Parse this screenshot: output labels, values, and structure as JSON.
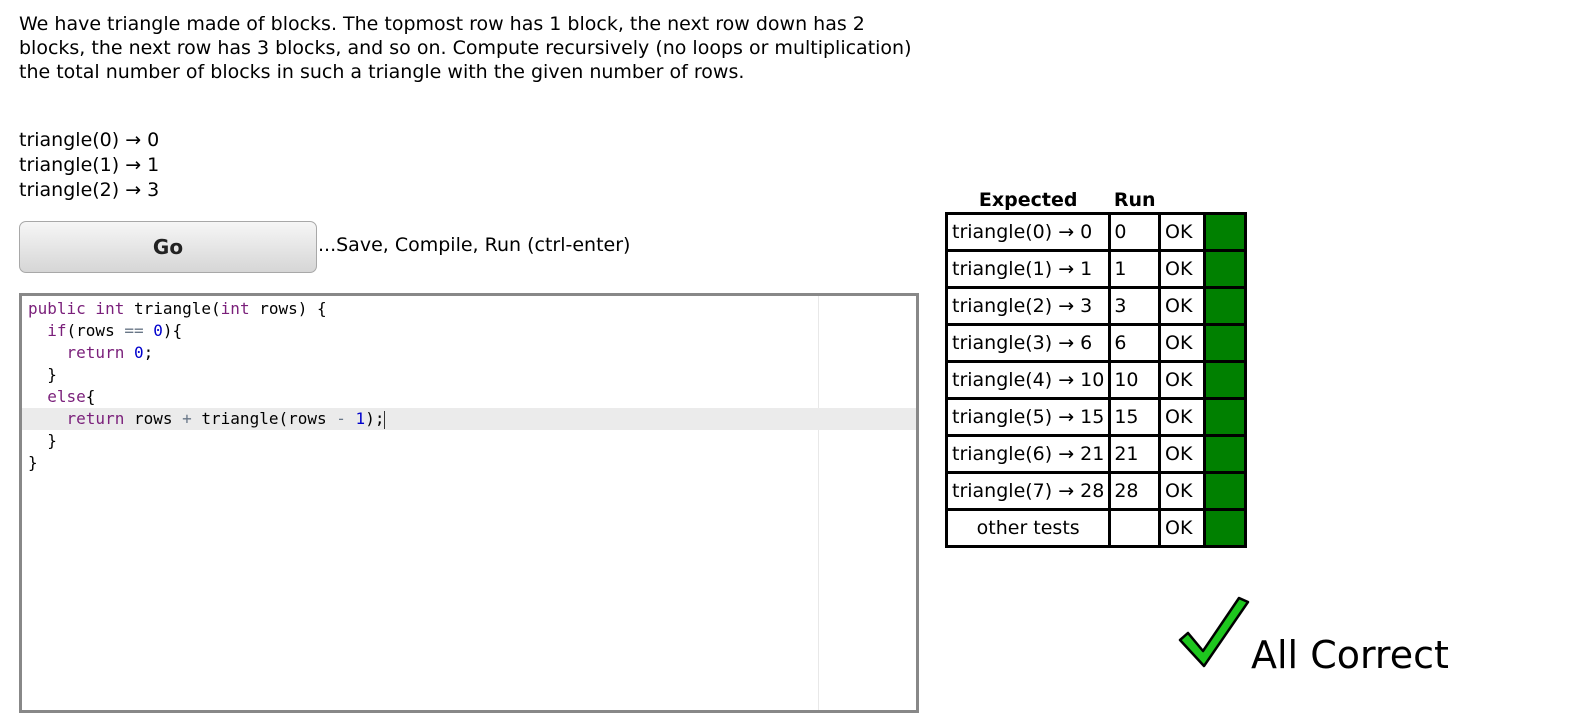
{
  "problem": {
    "description": "We have triangle made of blocks. The topmost row has 1 block, the next row down has 2 blocks, the next row has 3 blocks, and so on. Compute recursively (no loops or multiplication) the total number of blocks in such a triangle with the given number of rows.",
    "examples": [
      "triangle(0) → 0",
      "triangle(1) → 1",
      "triangle(2) → 3"
    ]
  },
  "controls": {
    "go_label": "Go",
    "go_hint": "...Save, Compile, Run (ctrl-enter)"
  },
  "editor": {
    "lines": [
      [
        {
          "t": "public int ",
          "c": "kw"
        },
        {
          "t": "triangle(",
          "c": "plain"
        },
        {
          "t": "int",
          "c": "kw"
        },
        {
          "t": " rows) {",
          "c": "plain"
        }
      ],
      [
        {
          "t": "  ",
          "c": "plain"
        },
        {
          "t": "if",
          "c": "kw"
        },
        {
          "t": "(rows ",
          "c": "plain"
        },
        {
          "t": "==",
          "c": "op"
        },
        {
          "t": " ",
          "c": "plain"
        },
        {
          "t": "0",
          "c": "num"
        },
        {
          "t": "){",
          "c": "plain"
        }
      ],
      [
        {
          "t": "    ",
          "c": "plain"
        },
        {
          "t": "return",
          "c": "kw"
        },
        {
          "t": " ",
          "c": "plain"
        },
        {
          "t": "0",
          "c": "num"
        },
        {
          "t": ";",
          "c": "plain"
        }
      ],
      [
        {
          "t": "  }",
          "c": "plain"
        }
      ],
      [
        {
          "t": "  ",
          "c": "plain"
        },
        {
          "t": "else",
          "c": "kw"
        },
        {
          "t": "{",
          "c": "plain"
        }
      ],
      [
        {
          "t": "    ",
          "c": "plain"
        },
        {
          "t": "return",
          "c": "kw"
        },
        {
          "t": " rows ",
          "c": "plain"
        },
        {
          "t": "+",
          "c": "op"
        },
        {
          "t": " triangle(rows ",
          "c": "plain"
        },
        {
          "t": "-",
          "c": "op"
        },
        {
          "t": " ",
          "c": "plain"
        },
        {
          "t": "1",
          "c": "num"
        },
        {
          "t": ");",
          "c": "plain"
        }
      ],
      [
        {
          "t": "  }",
          "c": "plain"
        }
      ],
      [
        {
          "t": "}",
          "c": "plain"
        }
      ]
    ],
    "active_line": 5,
    "colors": {
      "kw": "#7a1f7a",
      "num": "#0000cd",
      "op": "#687687",
      "plain": "#000000"
    }
  },
  "results": {
    "headers": {
      "expected": "Expected",
      "run": "Run"
    },
    "rows": [
      {
        "expected": "triangle(0) → 0",
        "run": "0",
        "status": "OK"
      },
      {
        "expected": "triangle(1) → 1",
        "run": "1",
        "status": "OK"
      },
      {
        "expected": "triangle(2) → 3",
        "run": "3",
        "status": "OK"
      },
      {
        "expected": "triangle(3) → 6",
        "run": "6",
        "status": "OK"
      },
      {
        "expected": "triangle(4) → 10",
        "run": "10",
        "status": "OK"
      },
      {
        "expected": "triangle(5) → 15",
        "run": "15",
        "status": "OK"
      },
      {
        "expected": "triangle(6) → 21",
        "run": "21",
        "status": "OK"
      },
      {
        "expected": "triangle(7) → 28",
        "run": "28",
        "status": "OK"
      },
      {
        "expected": "other tests",
        "run": "",
        "status": "OK"
      }
    ],
    "pass_color": "#008000"
  },
  "summary": {
    "icon": "checkmark-icon",
    "text": "All Correct",
    "check_color": "#1ec61e"
  }
}
